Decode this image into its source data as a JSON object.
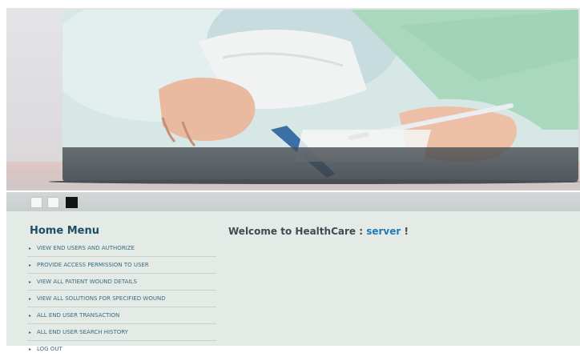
{
  "banner": {
    "image_alt_icon": "medical-hands-photo",
    "slides": [
      {
        "state": "inactive"
      },
      {
        "state": "inactive"
      },
      {
        "state": "active"
      }
    ]
  },
  "sidebar": {
    "title": "Home Menu",
    "bullet_icon": "triangle-bullet-icon",
    "items": [
      {
        "label": "VIEW END USERS AND AUTHORIZE"
      },
      {
        "label": "PROVIDE ACCESS PERMISSION TO USER"
      },
      {
        "label": "VIEW ALL PATIENT WOUND DETAILS"
      },
      {
        "label": "VIEW ALL SOLUTIONS FOR SPECIFIED WOUND"
      },
      {
        "label": "ALL END USER TRANSACTION"
      },
      {
        "label": "ALL END USER SEARCH HISTORY"
      },
      {
        "label": "LOG OUT"
      }
    ]
  },
  "main": {
    "welcome_prefix": "Welcome to HealthCare : ",
    "username": "server",
    "welcome_suffix": " !"
  },
  "colors": {
    "menu_title": "#1f4d63",
    "menu_link": "#3a6b82",
    "username": "#2479b3",
    "content_bg": "#e4ebe6"
  }
}
